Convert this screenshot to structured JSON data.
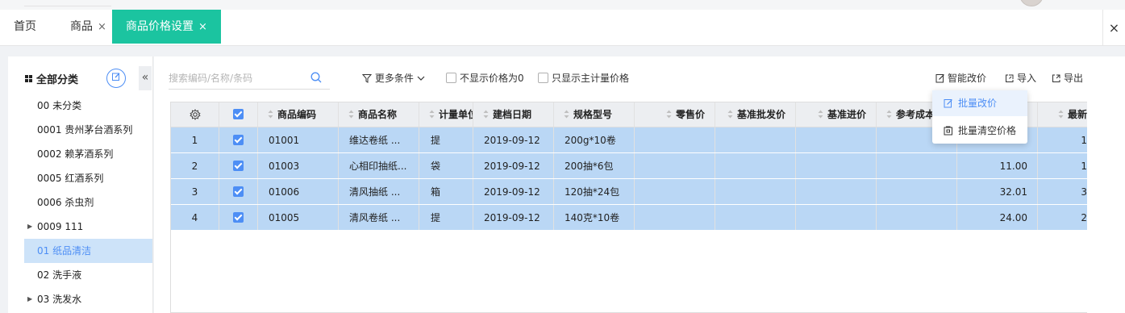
{
  "tabs": [
    {
      "label": "首页",
      "closable": false,
      "active": false
    },
    {
      "label": "商品",
      "closable": true,
      "active": false
    },
    {
      "label": "商品价格设置",
      "closable": true,
      "active": true
    }
  ],
  "close_symbol": "×",
  "sidebar": {
    "title": "全部分类",
    "categories": [
      {
        "label": "00 未分类",
        "expandable": false,
        "selected": false
      },
      {
        "label": "0001 贵州茅台酒系列",
        "expandable": false,
        "selected": false
      },
      {
        "label": "0002 赖茅酒系列",
        "expandable": false,
        "selected": false
      },
      {
        "label": "0005 红酒系列",
        "expandable": false,
        "selected": false
      },
      {
        "label": "0006 杀虫剂",
        "expandable": false,
        "selected": false
      },
      {
        "label": "0009 111",
        "expandable": true,
        "selected": false
      },
      {
        "label": "01 纸品清洁",
        "expandable": false,
        "selected": true
      },
      {
        "label": "02 洗手液",
        "expandable": false,
        "selected": false
      },
      {
        "label": "03 洗发水",
        "expandable": true,
        "selected": false
      }
    ]
  },
  "toolbar": {
    "search_placeholder": "搜索编码/名称/条码",
    "more_filters": "更多条件",
    "hide_zero_price": "不显示价格为0",
    "main_unit_only": "只显示主计量价格",
    "smart_price": "智能改价",
    "import": "导入",
    "export": "导出"
  },
  "dropdown": {
    "items": [
      {
        "label": "批量改价",
        "icon": "edit-icon",
        "highlighted": true
      },
      {
        "label": "批量清空价格",
        "icon": "clear-icon",
        "highlighted": false
      }
    ]
  },
  "table": {
    "headers": [
      "商品编码",
      "商品名称",
      "计量单位",
      "建档日期",
      "规格型号",
      "零售价",
      "基准批发价",
      "基准进价",
      "参考成本",
      "",
      "最新"
    ],
    "rows": [
      {
        "idx": "1",
        "code": "01001",
        "name": "维达卷纸 ...",
        "unit": "提",
        "date": "2019-09-12",
        "spec": "200g*10卷",
        "price9": "",
        "price10": "1"
      },
      {
        "idx": "2",
        "code": "01003",
        "name": "心相印抽纸...",
        "unit": "袋",
        "date": "2019-09-12",
        "spec": "200抽*6包",
        "price9": "11.00",
        "price10": "1"
      },
      {
        "idx": "3",
        "code": "01006",
        "name": "清风抽纸 ...",
        "unit": "箱",
        "date": "2019-09-12",
        "spec": "120抽*24包",
        "price9": "32.01",
        "price10": "3"
      },
      {
        "idx": "4",
        "code": "01005",
        "name": "清风卷纸 ...",
        "unit": "提",
        "date": "2019-09-12",
        "spec": "140克*10卷",
        "price9": "24.00",
        "price10": "2"
      }
    ]
  },
  "colors": {
    "accent": "#1bc4a0",
    "primary": "#4d8ef5",
    "row_selected": "#bad7f5"
  }
}
